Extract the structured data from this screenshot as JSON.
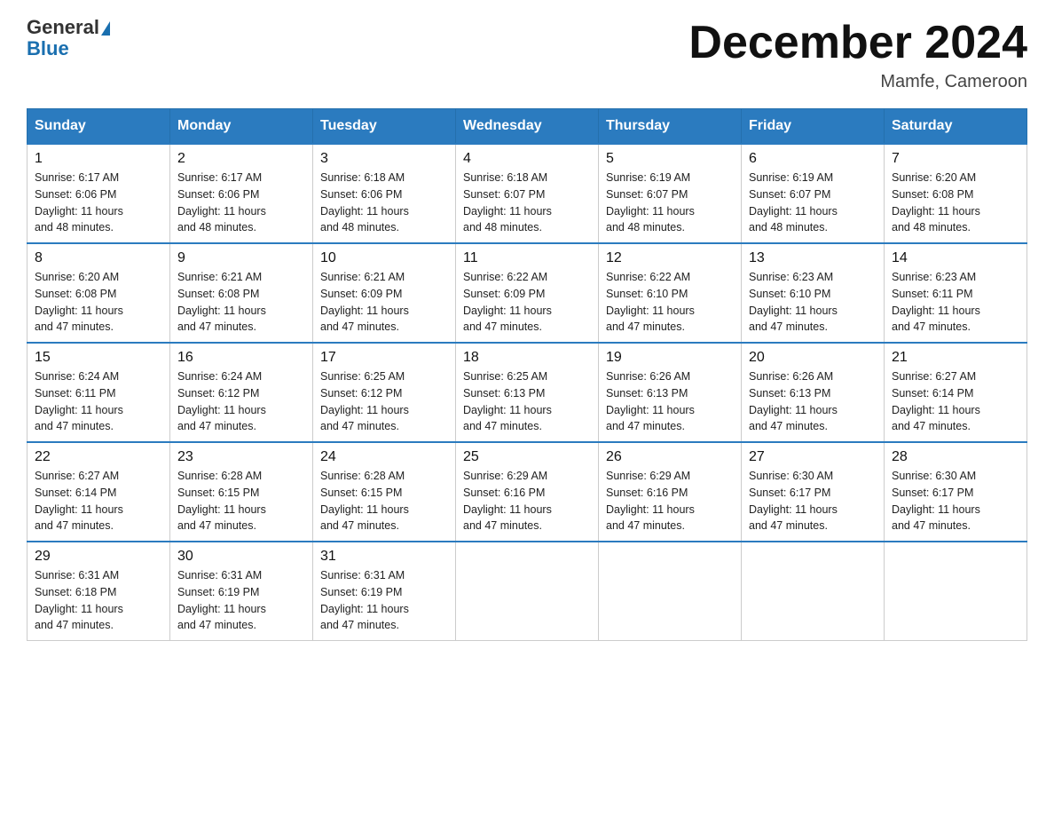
{
  "header": {
    "logo_general": "General",
    "logo_blue": "Blue",
    "month_title": "December 2024",
    "location": "Mamfe, Cameroon"
  },
  "days_of_week": [
    "Sunday",
    "Monday",
    "Tuesday",
    "Wednesday",
    "Thursday",
    "Friday",
    "Saturday"
  ],
  "weeks": [
    [
      {
        "day": "1",
        "sunrise": "6:17 AM",
        "sunset": "6:06 PM",
        "daylight": "11 hours and 48 minutes."
      },
      {
        "day": "2",
        "sunrise": "6:17 AM",
        "sunset": "6:06 PM",
        "daylight": "11 hours and 48 minutes."
      },
      {
        "day": "3",
        "sunrise": "6:18 AM",
        "sunset": "6:06 PM",
        "daylight": "11 hours and 48 minutes."
      },
      {
        "day": "4",
        "sunrise": "6:18 AM",
        "sunset": "6:07 PM",
        "daylight": "11 hours and 48 minutes."
      },
      {
        "day": "5",
        "sunrise": "6:19 AM",
        "sunset": "6:07 PM",
        "daylight": "11 hours and 48 minutes."
      },
      {
        "day": "6",
        "sunrise": "6:19 AM",
        "sunset": "6:07 PM",
        "daylight": "11 hours and 48 minutes."
      },
      {
        "day": "7",
        "sunrise": "6:20 AM",
        "sunset": "6:08 PM",
        "daylight": "11 hours and 48 minutes."
      }
    ],
    [
      {
        "day": "8",
        "sunrise": "6:20 AM",
        "sunset": "6:08 PM",
        "daylight": "11 hours and 47 minutes."
      },
      {
        "day": "9",
        "sunrise": "6:21 AM",
        "sunset": "6:08 PM",
        "daylight": "11 hours and 47 minutes."
      },
      {
        "day": "10",
        "sunrise": "6:21 AM",
        "sunset": "6:09 PM",
        "daylight": "11 hours and 47 minutes."
      },
      {
        "day": "11",
        "sunrise": "6:22 AM",
        "sunset": "6:09 PM",
        "daylight": "11 hours and 47 minutes."
      },
      {
        "day": "12",
        "sunrise": "6:22 AM",
        "sunset": "6:10 PM",
        "daylight": "11 hours and 47 minutes."
      },
      {
        "day": "13",
        "sunrise": "6:23 AM",
        "sunset": "6:10 PM",
        "daylight": "11 hours and 47 minutes."
      },
      {
        "day": "14",
        "sunrise": "6:23 AM",
        "sunset": "6:11 PM",
        "daylight": "11 hours and 47 minutes."
      }
    ],
    [
      {
        "day": "15",
        "sunrise": "6:24 AM",
        "sunset": "6:11 PM",
        "daylight": "11 hours and 47 minutes."
      },
      {
        "day": "16",
        "sunrise": "6:24 AM",
        "sunset": "6:12 PM",
        "daylight": "11 hours and 47 minutes."
      },
      {
        "day": "17",
        "sunrise": "6:25 AM",
        "sunset": "6:12 PM",
        "daylight": "11 hours and 47 minutes."
      },
      {
        "day": "18",
        "sunrise": "6:25 AM",
        "sunset": "6:13 PM",
        "daylight": "11 hours and 47 minutes."
      },
      {
        "day": "19",
        "sunrise": "6:26 AM",
        "sunset": "6:13 PM",
        "daylight": "11 hours and 47 minutes."
      },
      {
        "day": "20",
        "sunrise": "6:26 AM",
        "sunset": "6:13 PM",
        "daylight": "11 hours and 47 minutes."
      },
      {
        "day": "21",
        "sunrise": "6:27 AM",
        "sunset": "6:14 PM",
        "daylight": "11 hours and 47 minutes."
      }
    ],
    [
      {
        "day": "22",
        "sunrise": "6:27 AM",
        "sunset": "6:14 PM",
        "daylight": "11 hours and 47 minutes."
      },
      {
        "day": "23",
        "sunrise": "6:28 AM",
        "sunset": "6:15 PM",
        "daylight": "11 hours and 47 minutes."
      },
      {
        "day": "24",
        "sunrise": "6:28 AM",
        "sunset": "6:15 PM",
        "daylight": "11 hours and 47 minutes."
      },
      {
        "day": "25",
        "sunrise": "6:29 AM",
        "sunset": "6:16 PM",
        "daylight": "11 hours and 47 minutes."
      },
      {
        "day": "26",
        "sunrise": "6:29 AM",
        "sunset": "6:16 PM",
        "daylight": "11 hours and 47 minutes."
      },
      {
        "day": "27",
        "sunrise": "6:30 AM",
        "sunset": "6:17 PM",
        "daylight": "11 hours and 47 minutes."
      },
      {
        "day": "28",
        "sunrise": "6:30 AM",
        "sunset": "6:17 PM",
        "daylight": "11 hours and 47 minutes."
      }
    ],
    [
      {
        "day": "29",
        "sunrise": "6:31 AM",
        "sunset": "6:18 PM",
        "daylight": "11 hours and 47 minutes."
      },
      {
        "day": "30",
        "sunrise": "6:31 AM",
        "sunset": "6:19 PM",
        "daylight": "11 hours and 47 minutes."
      },
      {
        "day": "31",
        "sunrise": "6:31 AM",
        "sunset": "6:19 PM",
        "daylight": "11 hours and 47 minutes."
      },
      null,
      null,
      null,
      null
    ]
  ],
  "labels": {
    "sunrise": "Sunrise:",
    "sunset": "Sunset:",
    "daylight": "Daylight:"
  }
}
